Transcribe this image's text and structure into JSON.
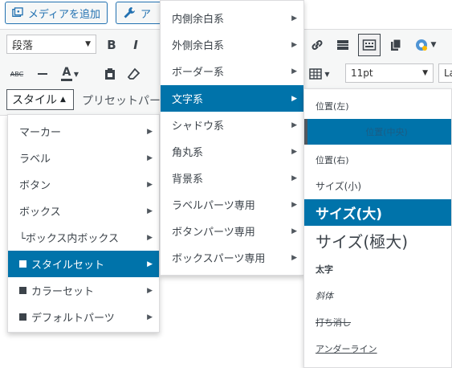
{
  "topbar": {
    "media_label": "メディアを追加",
    "addon_label": "ア"
  },
  "toolbar": {
    "row1": {
      "format_select": "段落",
      "bold": "B",
      "italic": "I"
    },
    "row2": {
      "strike": "ABC",
      "font_color": "A",
      "font_size_select": "11pt",
      "font_family_select": "La"
    },
    "row3": {
      "style_button": "スタイル",
      "preset_label": "プリセットパー"
    }
  },
  "menu_style": {
    "items": [
      {
        "label": "マーカー"
      },
      {
        "label": "ラベル"
      },
      {
        "label": "ボタン"
      },
      {
        "label": "ボックス"
      },
      {
        "label": "└ボックス内ボックス"
      },
      {
        "label": "スタイルセット"
      },
      {
        "label": "カラーセット"
      },
      {
        "label": "デフォルトパーツ"
      }
    ]
  },
  "menu_styleset": {
    "items": [
      {
        "label": "内側余白系"
      },
      {
        "label": "外側余白系"
      },
      {
        "label": "ボーダー系"
      },
      {
        "label": "文字系"
      },
      {
        "label": "シャドウ系"
      },
      {
        "label": "角丸系"
      },
      {
        "label": "背景系"
      },
      {
        "label": "ラベルパーツ専用"
      },
      {
        "label": "ボタンパーツ専用"
      },
      {
        "label": "ボックスパーツ専用"
      }
    ]
  },
  "menu_text": {
    "items": [
      {
        "label": "位置(左)"
      },
      {
        "label": "位置(中央)"
      },
      {
        "label": "位置(右)"
      },
      {
        "label": "サイズ(小)"
      },
      {
        "label": "サイズ(大)"
      },
      {
        "label": "サイズ(極大)"
      },
      {
        "label": "太字"
      },
      {
        "label": "斜体"
      },
      {
        "label": "打ち消し"
      },
      {
        "label": "アンダーライン"
      }
    ]
  },
  "colors": {
    "accent": "#0073aa",
    "wp_blue": "#2271b1"
  }
}
